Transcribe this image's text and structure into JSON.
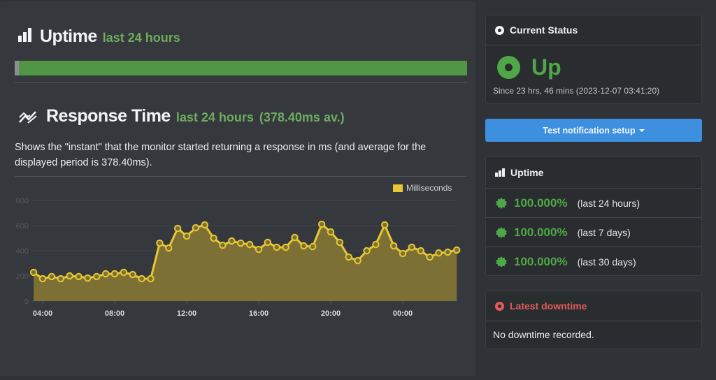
{
  "uptime_section": {
    "title": "Uptime",
    "subtitle": "last 24 hours",
    "bar_uptime_percent": 99
  },
  "response_section": {
    "title": "Response Time",
    "subtitle": "last 24 hours",
    "average": "(378.40ms av.)",
    "description": "Shows the \"instant\" that the monitor started returning a response in ms (and average for the displayed period is 378.40ms)."
  },
  "chart_data": {
    "type": "area",
    "title": "",
    "xlabel": "",
    "ylabel": "",
    "legend": {
      "label": "Milliseconds",
      "position": "top-right"
    },
    "series_color": "#e7c832",
    "ylim": [
      0,
      800
    ],
    "yticks": [
      0,
      200,
      400,
      600,
      800
    ],
    "xtick_labels": [
      "04:00",
      "08:00",
      "12:00",
      "16:00",
      "20:00",
      "00:00"
    ],
    "x_start_hour": 3.5,
    "x_step_hours": 0.5,
    "xtick_hours": [
      4,
      8,
      12,
      16,
      20,
      24
    ],
    "grid": true,
    "series": [
      {
        "name": "Milliseconds",
        "values": [
          228,
          178,
          195,
          178,
          200,
          195,
          183,
          195,
          217,
          217,
          228,
          211,
          178,
          178,
          461,
          422,
          578,
          517,
          583,
          606,
          500,
          444,
          478,
          461,
          450,
          411,
          467,
          428,
          428,
          506,
          439,
          433,
          611,
          550,
          467,
          350,
          322,
          400,
          450,
          606,
          439,
          378,
          428,
          400,
          350,
          383,
          389,
          406
        ]
      }
    ]
  },
  "current_status": {
    "header": "Current Status",
    "status": "Up",
    "since": "Since 23 hrs, 46 mins (2023-12-07 03:41:20)",
    "color": "#4fa847"
  },
  "notification_button": {
    "label": "Test notification setup"
  },
  "uptime_card": {
    "header": "Uptime",
    "rows": [
      {
        "percent": "100.000%",
        "period": "(last 24 hours)"
      },
      {
        "percent": "100.000%",
        "period": "(last 7 days)"
      },
      {
        "percent": "100.000%",
        "period": "(last 30 days)"
      }
    ]
  },
  "downtime_card": {
    "header": "Latest downtime",
    "message": "No downtime recorded.",
    "color": "#e05a5a"
  }
}
